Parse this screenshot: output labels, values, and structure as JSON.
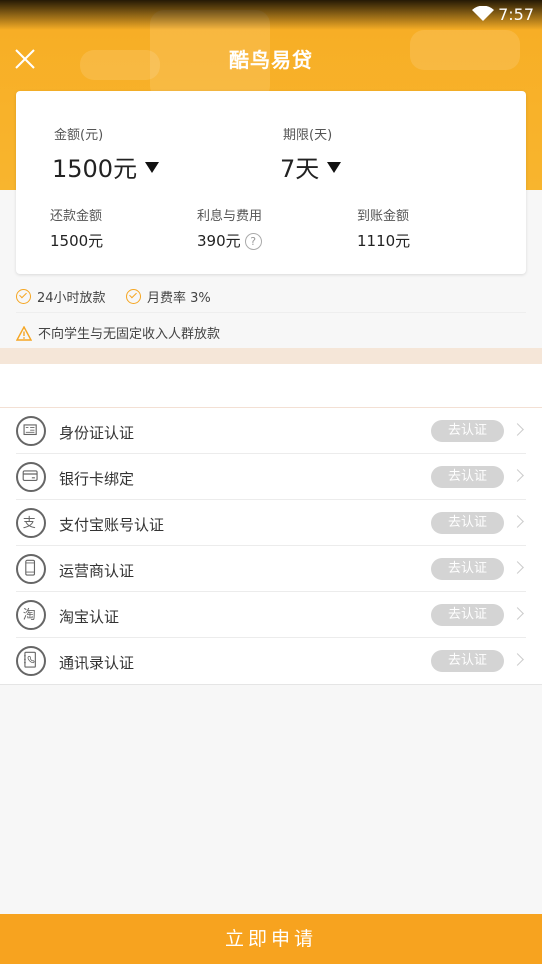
{
  "status_bar": {
    "time": "7:57"
  },
  "app": {
    "title": "酷鸟易贷"
  },
  "loan": {
    "amount_label": "金额(元)",
    "amount_value": "1500元",
    "term_label": "期限(天)",
    "term_value": "7天",
    "repay_label": "还款金额",
    "repay_value": "1500元",
    "fee_label": "利息与费用",
    "fee_value": "390元",
    "fee_help": "?",
    "receive_label": "到账金额",
    "receive_value": "1110元"
  },
  "features": [
    {
      "label": "24小时放款"
    },
    {
      "label": "月费率 3%"
    }
  ],
  "notice": "不向学生与无固定收入人群放款",
  "verifications": [
    {
      "label": "身份证认证",
      "action": "去认证",
      "icon": "id-card-icon"
    },
    {
      "label": "银行卡绑定",
      "action": "去认证",
      "icon": "bank-card-icon"
    },
    {
      "label": "支付宝账号认证",
      "action": "去认证",
      "icon": "alipay-icon"
    },
    {
      "label": "运营商认证",
      "action": "去认证",
      "icon": "phone-icon"
    },
    {
      "label": "淘宝认证",
      "action": "去认证",
      "icon": "taobao-icon"
    },
    {
      "label": "通讯录认证",
      "action": "去认证",
      "icon": "contacts-icon"
    }
  ],
  "apply_button": "立即申请",
  "colors": {
    "accent": "#f7a31f",
    "header": "#f8b52e",
    "badge": "#d4d4d4"
  }
}
